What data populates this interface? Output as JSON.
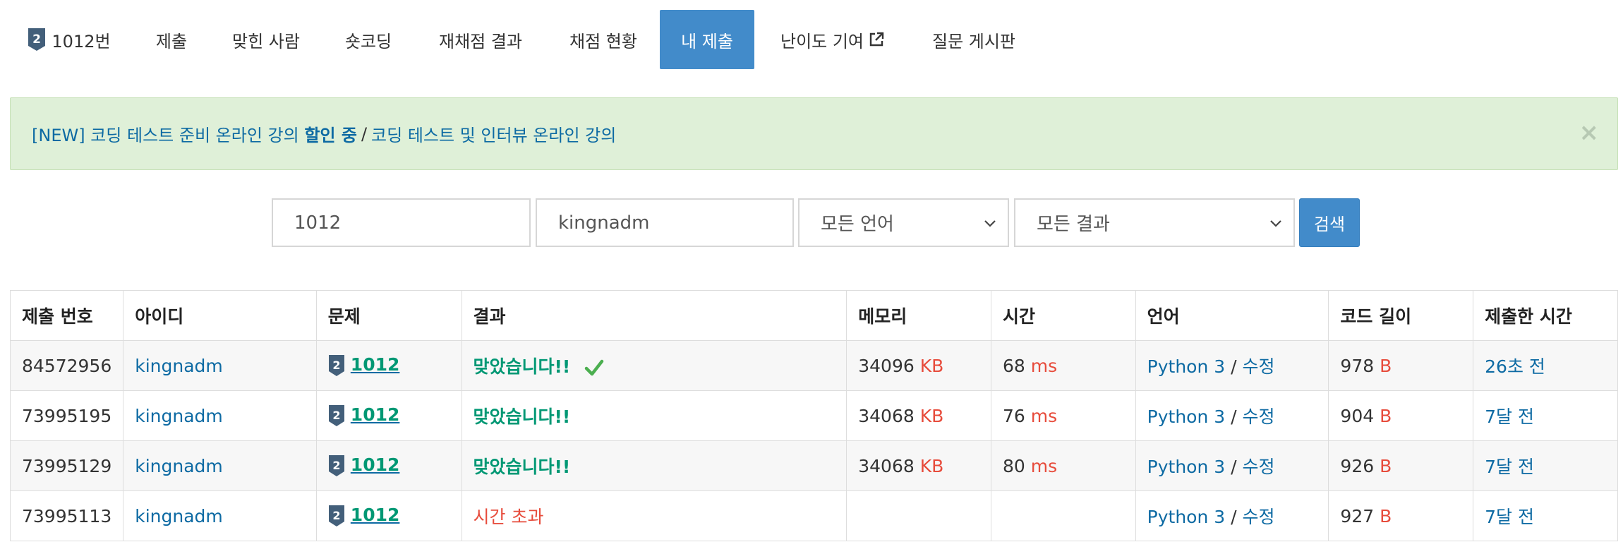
{
  "tabs": {
    "problem_number": "1012번",
    "items": [
      "제출",
      "맞힌 사람",
      "숏코딩",
      "재채점 결과",
      "채점 현황",
      "내 제출",
      "난이도 기여",
      "질문 게시판"
    ],
    "active": "내 제출",
    "tier_badge_icon": "silver-2-tier-icon",
    "external_icon": "external-link-icon"
  },
  "alert": {
    "new_tag": "[NEW]",
    "text_before": "코딩 테스트 준비 온라인 강의",
    "bold_text": "할인 중",
    "separator": "/",
    "text_after": "코딩 테스트 및 인터뷰 온라인 강의",
    "close_label": "×",
    "background": "#dff0d8"
  },
  "search": {
    "problem_value": "1012",
    "user_value": "kingnadm",
    "language_selected": "모든 언어",
    "result_selected": "모든 결과",
    "button_label": "검색"
  },
  "table": {
    "headers": [
      "제출 번호",
      "아이디",
      "문제",
      "결과",
      "메모리",
      "시간",
      "언어",
      "코드 길이",
      "제출한 시간"
    ],
    "rows": [
      {
        "id": "84572956",
        "user": "kingnadm",
        "problem": "1012",
        "result": "맞았습니다!!",
        "result_type": "accepted",
        "show_check": true,
        "memory": "34096",
        "memory_unit": "KB",
        "time": "68",
        "time_unit": "ms",
        "language": "Python 3",
        "lang_sep": "/",
        "edit": "수정",
        "code_length": "978",
        "code_unit": "B",
        "submitted": "26초 전"
      },
      {
        "id": "73995195",
        "user": "kingnadm",
        "problem": "1012",
        "result": "맞았습니다!!",
        "result_type": "accepted",
        "show_check": false,
        "memory": "34068",
        "memory_unit": "KB",
        "time": "76",
        "time_unit": "ms",
        "language": "Python 3",
        "lang_sep": "/",
        "edit": "수정",
        "code_length": "904",
        "code_unit": "B",
        "submitted": "7달 전"
      },
      {
        "id": "73995129",
        "user": "kingnadm",
        "problem": "1012",
        "result": "맞았습니다!!",
        "result_type": "accepted",
        "show_check": false,
        "memory": "34068",
        "memory_unit": "KB",
        "time": "80",
        "time_unit": "ms",
        "language": "Python 3",
        "lang_sep": "/",
        "edit": "수정",
        "code_length": "926",
        "code_unit": "B",
        "submitted": "7달 전"
      },
      {
        "id": "73995113",
        "user": "kingnadm",
        "problem": "1012",
        "result": "시간 초과",
        "result_type": "tle",
        "show_check": false,
        "memory": "",
        "memory_unit": "",
        "time": "",
        "time_unit": "",
        "language": "Python 3",
        "lang_sep": "/",
        "edit": "수정",
        "code_length": "927",
        "code_unit": "B",
        "submitted": "7달 전"
      }
    ]
  },
  "colors": {
    "accent": "#428bca",
    "link": "#0d6aa3",
    "accepted": "#009874",
    "error": "#e74c3c",
    "tier_silver": "#435f7a"
  }
}
